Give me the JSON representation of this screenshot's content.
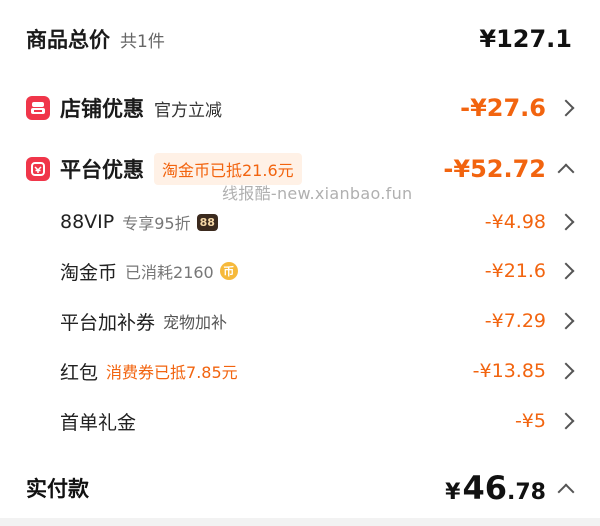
{
  "summary": {
    "title": "商品总价",
    "count": "共1件",
    "price": "¥127.1"
  },
  "shop_discount": {
    "label": "店铺优惠",
    "note": "官方立减",
    "amount": "-¥27.6"
  },
  "platform_discount": {
    "label": "平台优惠",
    "pill": "淘金币已抵21.6元",
    "amount": "-¥52.72"
  },
  "watermark": "线报酷-new.xianbao.fun",
  "items": [
    {
      "label": "88VIP",
      "note": "专享95折",
      "badge": "88",
      "amount": "-¥4.98"
    },
    {
      "label": "淘金币",
      "note": "已消耗2160",
      "coin": "币",
      "amount": "-¥21.6"
    },
    {
      "label": "平台加补券",
      "note": "宠物加补",
      "amount": "-¥7.29"
    },
    {
      "label": "红包",
      "note": "消费券已抵7.85元",
      "amount": "-¥13.85"
    },
    {
      "label": "首单礼金",
      "note": "",
      "amount": "-¥5"
    }
  ],
  "payment": {
    "label": "实付款",
    "yen": "¥",
    "integer": "46",
    "decimal": ".78"
  }
}
